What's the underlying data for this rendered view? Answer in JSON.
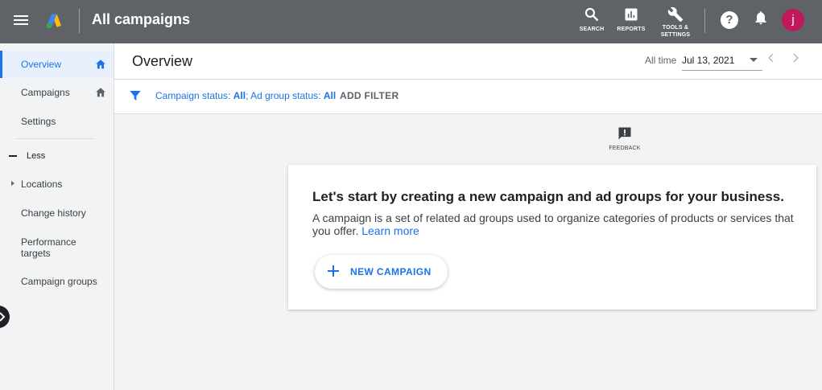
{
  "topbar": {
    "title": "All campaigns",
    "tools": {
      "search_label": "SEARCH",
      "reports_label": "REPORTS",
      "tools_label_line1": "TOOLS &",
      "tools_label_line2": "SETTINGS"
    },
    "help_glyph": "?",
    "avatar_initial": "j",
    "avatar_color": "#c2185b"
  },
  "sidebar": {
    "items": [
      {
        "label": "Overview",
        "active": true,
        "home_icon": true
      },
      {
        "label": "Campaigns",
        "home_icon": true
      },
      {
        "label": "Settings"
      },
      {
        "label": "Less"
      },
      {
        "label": "Locations",
        "expandable": true
      },
      {
        "label": "Change history"
      },
      {
        "label": "Performance targets"
      },
      {
        "label": "Campaign groups"
      }
    ]
  },
  "header": {
    "page_title": "Overview",
    "date_range_label": "All time",
    "date_value": "Jul 13, 2021"
  },
  "filters": {
    "campaign_status_label": "Campaign status: ",
    "campaign_status_value": "All",
    "separator": "; ",
    "ad_group_status_label": "Ad group status: ",
    "ad_group_status_value": "All",
    "add_filter_label": "ADD FILTER"
  },
  "feedback": {
    "label": "FEEDBACK"
  },
  "card": {
    "title": "Let's start by creating a new campaign and ad groups for your business.",
    "description": "A campaign is a set of related ad groups used to organize categories of products or services that you offer. ",
    "learn_more": "Learn more",
    "button_label": "NEW CAMPAIGN"
  },
  "colors": {
    "topbar": "#5f6368",
    "accent": "#1a73e8",
    "active_bg": "#e8f0fe",
    "background": "#f1f3f4"
  }
}
